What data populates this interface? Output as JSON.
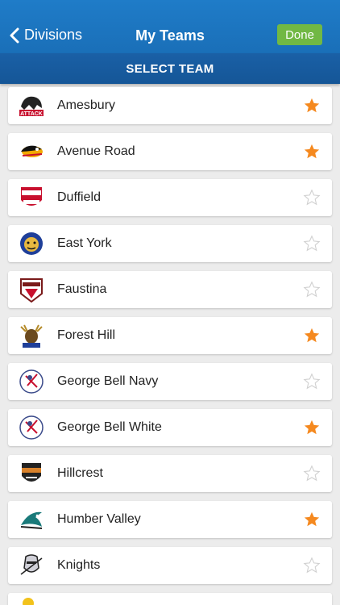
{
  "nav": {
    "back_label": "Divisions",
    "title": "My Teams",
    "done_label": "Done"
  },
  "section_title": "SELECT TEAM",
  "colors": {
    "nav": "#1f7cc8",
    "header": "#1a60a6",
    "done": "#71b844",
    "star_on": "#f5891f",
    "star_off": "#d0d0d0"
  },
  "teams": [
    {
      "name": "Amesbury",
      "favorite": true,
      "logo": "attack-logo"
    },
    {
      "name": "Avenue Road",
      "favorite": true,
      "logo": "duck-logo"
    },
    {
      "name": "Duffield",
      "favorite": false,
      "logo": "devils-logo"
    },
    {
      "name": "East York",
      "favorite": false,
      "logo": "bulldog-logo"
    },
    {
      "name": "Faustina",
      "favorite": false,
      "logo": "fury-logo"
    },
    {
      "name": "Forest Hill",
      "favorite": true,
      "logo": "moose-logo"
    },
    {
      "name": "George Bell Navy",
      "favorite": false,
      "logo": "titans-logo"
    },
    {
      "name": "George Bell White",
      "favorite": true,
      "logo": "titans-logo"
    },
    {
      "name": "Hillcrest",
      "favorite": false,
      "logo": "hillcrest-logo"
    },
    {
      "name": "Humber Valley",
      "favorite": true,
      "logo": "shark-logo"
    },
    {
      "name": "Knights",
      "favorite": false,
      "logo": "knight-logo"
    }
  ]
}
